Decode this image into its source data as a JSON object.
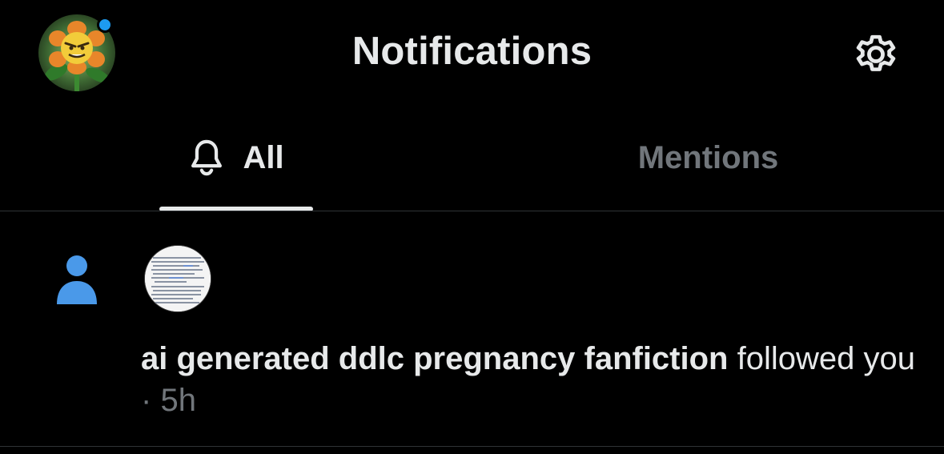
{
  "header": {
    "title": "Notifications",
    "avatar_icon": "profile-avatar-flower",
    "settings_icon": "gear-icon",
    "status_dot_color": "#1d9bf0"
  },
  "tabs": [
    {
      "label": "All",
      "icon": "bell-icon",
      "selected": true
    },
    {
      "label": "Mentions",
      "selected": false
    }
  ],
  "notifications": [
    {
      "type_icon": "person-icon",
      "type_icon_color": "#4a99e9",
      "name": "ai generated ddlc pregnancy fanfiction",
      "action": "followed you",
      "separator": "·",
      "time": "5h"
    }
  ],
  "colors": {
    "background": "#000000",
    "primary_text": "#e7e9ea",
    "secondary_text": "#71767b",
    "accent": "#1d9bf0",
    "divider": "#2f3336"
  }
}
